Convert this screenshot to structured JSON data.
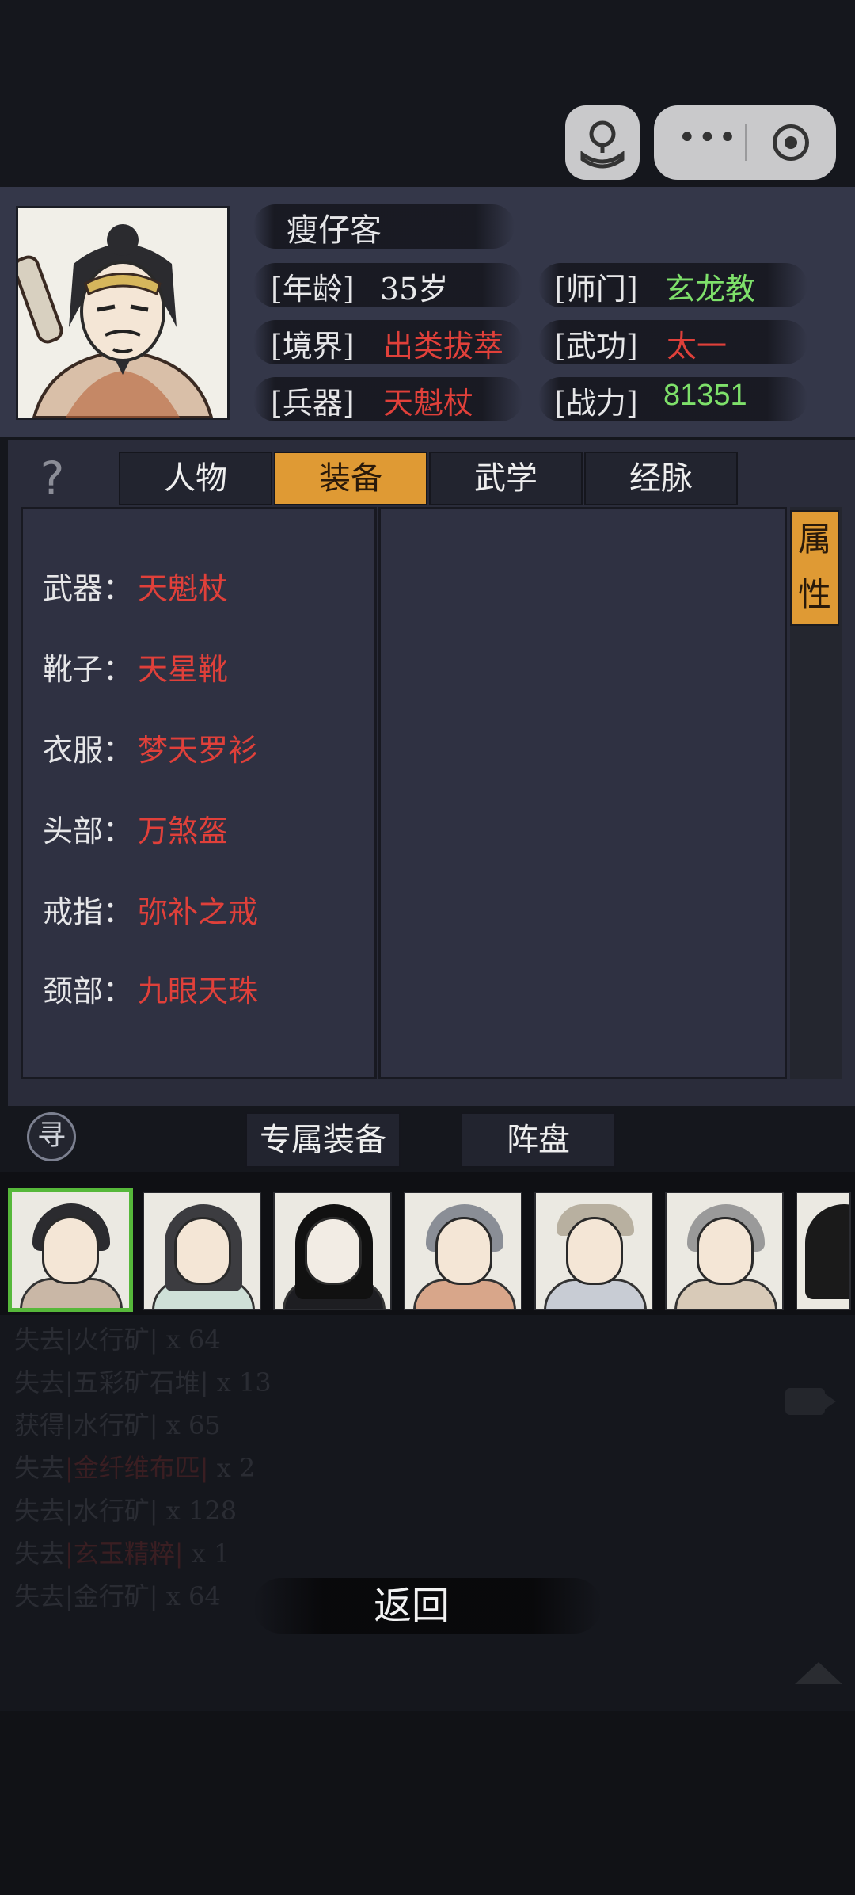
{
  "profile": {
    "name": "瘦仔客",
    "age_label": "[年龄]",
    "age": "35岁",
    "sect_label": "[师门]",
    "sect": "玄龙教",
    "realm_label": "[境界]",
    "realm": "出类拔萃",
    "skill_label": "[武功]",
    "skill": "太一",
    "weapon_label": "[兵器]",
    "weapon": "天魁杖",
    "power_label": "[战力]",
    "power": "81351"
  },
  "tabs": [
    {
      "label": "人物"
    },
    {
      "label": "装备"
    },
    {
      "label": "武学"
    },
    {
      "label": "经脉"
    }
  ],
  "active_tab": "装备",
  "help_icon": "?",
  "attr_tab": {
    "line1": "属",
    "line2": "性"
  },
  "equipment": [
    {
      "slot": "武器：",
      "item": "天魁杖"
    },
    {
      "slot": "靴子：",
      "item": "天星靴"
    },
    {
      "slot": "衣服：",
      "item": "梦天罗衫"
    },
    {
      "slot": "头部：",
      "item": "万煞盔"
    },
    {
      "slot": "戒指：",
      "item": "弥补之戒"
    },
    {
      "slot": "颈部：",
      "item": "九眼天珠"
    }
  ],
  "buttons": {
    "seek_icon": "寻",
    "exclusive": "专属装备",
    "formation": "阵盘"
  },
  "log": [
    {
      "action": "失去",
      "item": "|火行矿|",
      "qty": " x 64"
    },
    {
      "action": "失去",
      "item": "|五彩矿石堆|",
      "qty": " x 13"
    },
    {
      "action": "获得",
      "item": "|水行矿|",
      "qty": " x 65"
    },
    {
      "action": "失去",
      "item": "|金纤维布匹|",
      "qty": " x 2"
    },
    {
      "action": "失去",
      "item": "|水行矿|",
      "qty": " x 128"
    },
    {
      "action": "失去",
      "item": "|玄玉精粹|",
      "qty": " x 1"
    },
    {
      "action": "失去",
      "item": "|金行矿|",
      "qty": " x 64"
    }
  ],
  "return_label": "返回",
  "colors": {
    "accent": "#df9a34",
    "red_value": "#e0403a",
    "green_value": "#7ee06a",
    "selected_border": "#56b83a"
  }
}
